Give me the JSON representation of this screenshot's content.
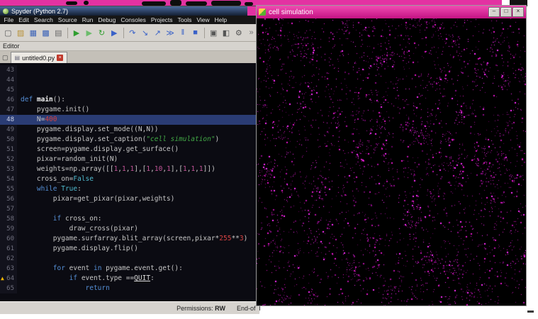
{
  "desktop": {
    "strip_color": "#e332a2",
    "artifact_color": "#121212"
  },
  "spyder": {
    "title": "Spyder (Python 2.7)",
    "menus": [
      "File",
      "Edit",
      "Search",
      "Source",
      "Run",
      "Debug",
      "Consoles",
      "Projects",
      "Tools",
      "View",
      "Help"
    ],
    "toolbar": [
      {
        "name": "new-file-icon",
        "glyph": "▢",
        "color": "#5a5a5a"
      },
      {
        "name": "open-file-icon",
        "glyph": "▨",
        "color": "#b8923a"
      },
      {
        "name": "save-icon",
        "glyph": "▦",
        "color": "#3a62b8"
      },
      {
        "name": "save-all-icon",
        "glyph": "▩",
        "color": "#3a62b8"
      },
      {
        "name": "print-icon",
        "glyph": "▤",
        "color": "#6a6a6a"
      },
      {
        "sep": true
      },
      {
        "name": "run-icon",
        "glyph": "▶",
        "color": "#2f9e2f"
      },
      {
        "name": "run-selection-icon",
        "glyph": "▶",
        "color": "#6cbc6c"
      },
      {
        "name": "rerun-icon",
        "glyph": "↻",
        "color": "#2f9e2f"
      },
      {
        "name": "debug-icon",
        "glyph": "▶",
        "color": "#3a62c8"
      },
      {
        "sep": true
      },
      {
        "name": "step-over-icon",
        "glyph": "↷",
        "color": "#3a62c8"
      },
      {
        "name": "step-into-icon",
        "glyph": "↘",
        "color": "#3a62c8"
      },
      {
        "name": "step-out-icon",
        "glyph": "↗",
        "color": "#3a62c8"
      },
      {
        "name": "continue-icon",
        "glyph": "≫",
        "color": "#3a62c8"
      },
      {
        "name": "pause-icon",
        "glyph": "‖",
        "color": "#3a62c8"
      },
      {
        "name": "stop-icon",
        "glyph": "■",
        "color": "#3a62c8"
      },
      {
        "sep": true
      },
      {
        "name": "fullscreen-icon",
        "glyph": "▣",
        "color": "#555555"
      },
      {
        "name": "layout-icon",
        "glyph": "◧",
        "color": "#555555"
      },
      {
        "name": "options-icon",
        "glyph": "⚙",
        "color": "#555555"
      },
      {
        "name": "interpreter-icon",
        "glyph": "»",
        "color": "#777777"
      }
    ],
    "editor_label": "Editor",
    "tab": {
      "label": "untitled0.py",
      "close_glyph": "×"
    },
    "status": {
      "permissions_label": "Permissions:",
      "permissions_value": "RW",
      "end_text": "End-of"
    },
    "code": {
      "highlight_line": 48,
      "warning_line": 64,
      "lines": [
        {
          "n": 43,
          "seg": []
        },
        {
          "n": 44,
          "seg": []
        },
        {
          "n": 45,
          "seg": []
        },
        {
          "n": 46,
          "seg": [
            [
              "def ",
              "kw"
            ],
            [
              "main",
              "fn"
            ],
            [
              "():",
              "p"
            ]
          ]
        },
        {
          "n": 47,
          "seg": [
            [
              "    pygame.init()",
              "p"
            ]
          ]
        },
        {
          "n": 48,
          "seg": [
            [
              "    N=",
              "p"
            ],
            [
              "400",
              "numr"
            ]
          ]
        },
        {
          "n": 49,
          "seg": [
            [
              "    pygame.display.set_mode((N,N))",
              "p"
            ]
          ]
        },
        {
          "n": 50,
          "seg": [
            [
              "    pygame.display.set_caption(",
              "p"
            ],
            [
              "\"cell simulation\"",
              "str"
            ],
            [
              ")",
              "p"
            ]
          ]
        },
        {
          "n": 51,
          "seg": [
            [
              "    screen=pygame.display.get_surface()",
              "p"
            ]
          ]
        },
        {
          "n": 52,
          "seg": [
            [
              "    pixar=random_init(N)",
              "p"
            ]
          ]
        },
        {
          "n": 53,
          "seg": [
            [
              "    weights=np.array([[",
              "p"
            ],
            [
              "1",
              "num"
            ],
            [
              ",",
              "p"
            ],
            [
              "1",
              "num"
            ],
            [
              ",",
              "p"
            ],
            [
              "1",
              "num"
            ],
            [
              "],[",
              "p"
            ],
            [
              "1",
              "num"
            ],
            [
              ",",
              "p"
            ],
            [
              "10",
              "num"
            ],
            [
              ",",
              "p"
            ],
            [
              "1",
              "num"
            ],
            [
              "],[",
              "p"
            ],
            [
              "1",
              "num"
            ],
            [
              ",",
              "p"
            ],
            [
              "1",
              "num"
            ],
            [
              ",",
              "p"
            ],
            [
              "1",
              "num"
            ],
            [
              "]])",
              "p"
            ]
          ]
        },
        {
          "n": 54,
          "seg": [
            [
              "    cross_on=",
              "p"
            ],
            [
              "False",
              "bi"
            ]
          ]
        },
        {
          "n": 55,
          "seg": [
            [
              "    ",
              "p"
            ],
            [
              "while",
              "kw"
            ],
            [
              " ",
              "p"
            ],
            [
              "True",
              "bi"
            ],
            [
              ":",
              "p"
            ]
          ]
        },
        {
          "n": 56,
          "seg": [
            [
              "        pixar=get_pixar(pixar,weights)",
              "p"
            ]
          ]
        },
        {
          "n": 57,
          "seg": []
        },
        {
          "n": 58,
          "seg": [
            [
              "        ",
              "p"
            ],
            [
              "if",
              "kw"
            ],
            [
              " cross_on:",
              "p"
            ]
          ]
        },
        {
          "n": 59,
          "seg": [
            [
              "            draw_cross(pixar)",
              "p"
            ]
          ]
        },
        {
          "n": 60,
          "seg": [
            [
              "        pygame.surfarray.blit_array(screen,pixar*",
              "p"
            ],
            [
              "255",
              "numr"
            ],
            [
              "**",
              "p"
            ],
            [
              "3",
              "numr"
            ],
            [
              ")",
              "p"
            ]
          ]
        },
        {
          "n": 61,
          "seg": [
            [
              "        pygame.display.flip()",
              "p"
            ]
          ]
        },
        {
          "n": 62,
          "seg": []
        },
        {
          "n": 63,
          "seg": [
            [
              "        ",
              "p"
            ],
            [
              "for",
              "kw"
            ],
            [
              " event ",
              "p"
            ],
            [
              "in",
              "kw"
            ],
            [
              " pygame.event.get():",
              "p"
            ]
          ]
        },
        {
          "n": 64,
          "seg": [
            [
              "            ",
              "p"
            ],
            [
              "if",
              "kw"
            ],
            [
              " event.type ==",
              "p"
            ],
            [
              "QUIT",
              "quit"
            ],
            [
              ":",
              "p"
            ]
          ]
        },
        {
          "n": 65,
          "seg": [
            [
              "                ",
              "p"
            ],
            [
              "return",
              "kw"
            ]
          ]
        }
      ]
    }
  },
  "pygame_window": {
    "title": "cell simulation",
    "buttons": [
      {
        "name": "minimize-button",
        "glyph": "–"
      },
      {
        "name": "maximize-button",
        "glyph": "□"
      },
      {
        "name": "close-button",
        "glyph": "×"
      }
    ],
    "sim": {
      "bg": "#000000",
      "dot_count": 2600,
      "cluster_count": 70,
      "cluster_size": 14,
      "dot_colors": [
        "#ff2dff",
        "#e316c9",
        "#b511a6",
        "#8a0c86",
        "#62065e"
      ]
    }
  }
}
